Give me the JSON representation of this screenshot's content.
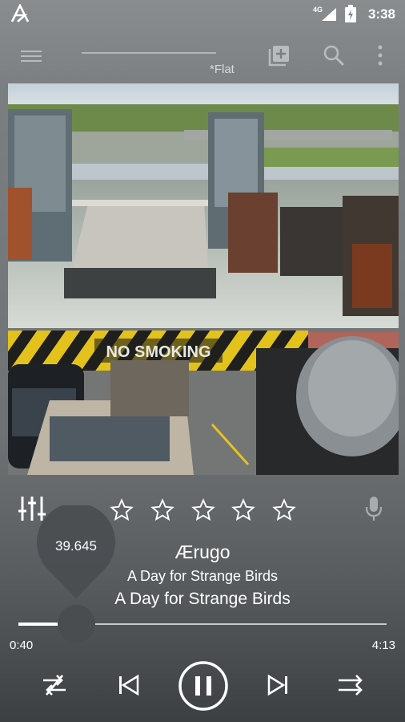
{
  "status_bar": {
    "network": "4G",
    "time": "3:38"
  },
  "toolbar": {
    "preset": "*Flat",
    "icons": [
      "menu-icon",
      "add-queue-icon",
      "search-icon",
      "more-vert-icon"
    ]
  },
  "album_art": {
    "sign_text": "NO SMOKING"
  },
  "rating": {
    "stars": 0,
    "max": 5
  },
  "track": {
    "title": "Ærugo",
    "album": "A Day for Strange Birds",
    "artist": "A Day for Strange Birds"
  },
  "seek": {
    "bubble_value": "39.645",
    "elapsed": "0:40",
    "total": "4:13",
    "progress": 0.158
  },
  "colors": {
    "accent": "#4a4d50",
    "stripe_yellow": "#e3c21c",
    "stripe_black": "#1f1f1d"
  }
}
